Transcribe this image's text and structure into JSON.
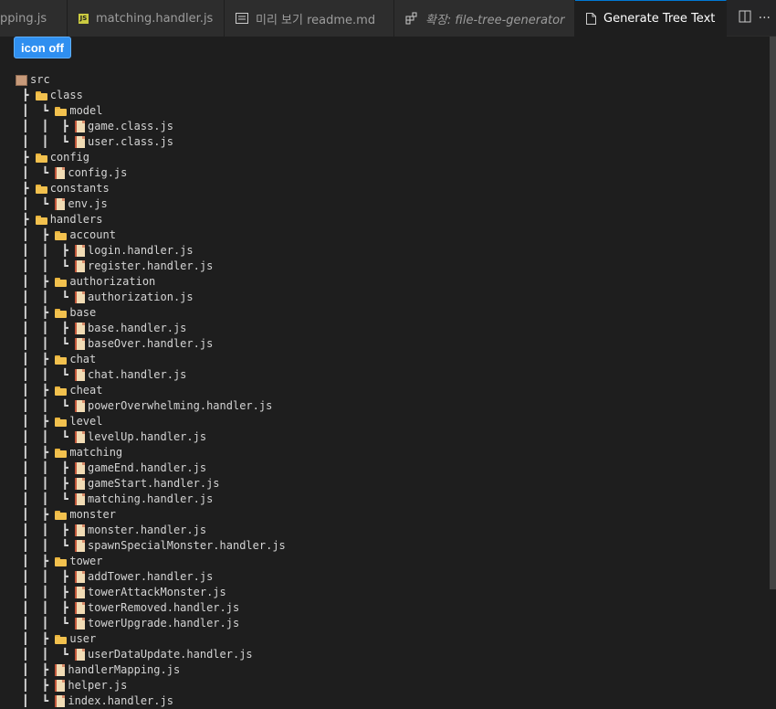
{
  "tabs": [
    {
      "label": "pping.js",
      "icon": "js-icon",
      "active": false
    },
    {
      "label": "matching.handler.js",
      "icon": "js-icon",
      "active": false
    },
    {
      "label": "미리 보기 readme.md",
      "icon": "preview-icon",
      "active": false
    },
    {
      "label": "확장: file-tree-generator",
      "icon": "extension-icon",
      "active": false
    },
    {
      "label": "Generate Tree Text",
      "icon": "file-icon",
      "active": true
    }
  ],
  "tab_actions": {
    "split": "split-editor-icon",
    "more": "···"
  },
  "icon_off_button": "icon off",
  "colors": {
    "accent": "#2f8ff0",
    "background": "#1e1e1e",
    "folder": "#f2c14e"
  },
  "tree": [
    {
      "prefix": "",
      "type": "root",
      "name": "src"
    },
    {
      "prefix": " ┣ ",
      "type": "folder",
      "name": "class"
    },
    {
      "prefix": " ┃  ┗ ",
      "type": "folder",
      "name": "model"
    },
    {
      "prefix": " ┃  ┃  ┣ ",
      "type": "file",
      "name": "game.class.js"
    },
    {
      "prefix": " ┃  ┃  ┗ ",
      "type": "file",
      "name": "user.class.js"
    },
    {
      "prefix": " ┣ ",
      "type": "folder",
      "name": "config"
    },
    {
      "prefix": " ┃  ┗ ",
      "type": "file",
      "name": "config.js"
    },
    {
      "prefix": " ┣ ",
      "type": "folder",
      "name": "constants"
    },
    {
      "prefix": " ┃  ┗ ",
      "type": "file",
      "name": "env.js"
    },
    {
      "prefix": " ┣ ",
      "type": "folder",
      "name": "handlers"
    },
    {
      "prefix": " ┃  ┣ ",
      "type": "folder",
      "name": "account"
    },
    {
      "prefix": " ┃  ┃  ┣ ",
      "type": "file",
      "name": "login.handler.js"
    },
    {
      "prefix": " ┃  ┃  ┗ ",
      "type": "file",
      "name": "register.handler.js"
    },
    {
      "prefix": " ┃  ┣ ",
      "type": "folder",
      "name": "authorization"
    },
    {
      "prefix": " ┃  ┃  ┗ ",
      "type": "file",
      "name": "authorization.js"
    },
    {
      "prefix": " ┃  ┣ ",
      "type": "folder",
      "name": "base"
    },
    {
      "prefix": " ┃  ┃  ┣ ",
      "type": "file",
      "name": "base.handler.js"
    },
    {
      "prefix": " ┃  ┃  ┗ ",
      "type": "file",
      "name": "baseOver.handler.js"
    },
    {
      "prefix": " ┃  ┣ ",
      "type": "folder",
      "name": "chat"
    },
    {
      "prefix": " ┃  ┃  ┗ ",
      "type": "file",
      "name": "chat.handler.js"
    },
    {
      "prefix": " ┃  ┣ ",
      "type": "folder",
      "name": "cheat"
    },
    {
      "prefix": " ┃  ┃  ┗ ",
      "type": "file",
      "name": "powerOverwhelming.handler.js"
    },
    {
      "prefix": " ┃  ┣ ",
      "type": "folder",
      "name": "level"
    },
    {
      "prefix": " ┃  ┃  ┗ ",
      "type": "file",
      "name": "levelUp.handler.js"
    },
    {
      "prefix": " ┃  ┣ ",
      "type": "folder",
      "name": "matching"
    },
    {
      "prefix": " ┃  ┃  ┣ ",
      "type": "file",
      "name": "gameEnd.handler.js"
    },
    {
      "prefix": " ┃  ┃  ┣ ",
      "type": "file",
      "name": "gameStart.handler.js"
    },
    {
      "prefix": " ┃  ┃  ┗ ",
      "type": "file",
      "name": "matching.handler.js"
    },
    {
      "prefix": " ┃  ┣ ",
      "type": "folder",
      "name": "monster"
    },
    {
      "prefix": " ┃  ┃  ┣ ",
      "type": "file",
      "name": "monster.handler.js"
    },
    {
      "prefix": " ┃  ┃  ┗ ",
      "type": "file",
      "name": "spawnSpecialMonster.handler.js"
    },
    {
      "prefix": " ┃  ┣ ",
      "type": "folder",
      "name": "tower"
    },
    {
      "prefix": " ┃  ┃  ┣ ",
      "type": "file",
      "name": "addTower.handler.js"
    },
    {
      "prefix": " ┃  ┃  ┣ ",
      "type": "file",
      "name": "towerAttackMonster.js"
    },
    {
      "prefix": " ┃  ┃  ┣ ",
      "type": "file",
      "name": "towerRemoved.handler.js"
    },
    {
      "prefix": " ┃  ┃  ┗ ",
      "type": "file",
      "name": "towerUpgrade.handler.js"
    },
    {
      "prefix": " ┃  ┣ ",
      "type": "folder",
      "name": "user"
    },
    {
      "prefix": " ┃  ┃  ┗ ",
      "type": "file",
      "name": "userDataUpdate.handler.js"
    },
    {
      "prefix": " ┃  ┣ ",
      "type": "file",
      "name": "handlerMapping.js"
    },
    {
      "prefix": " ┃  ┣ ",
      "type": "file",
      "name": "helper.js"
    },
    {
      "prefix": " ┃  ┗ ",
      "type": "file",
      "name": "index.handler.js"
    }
  ]
}
